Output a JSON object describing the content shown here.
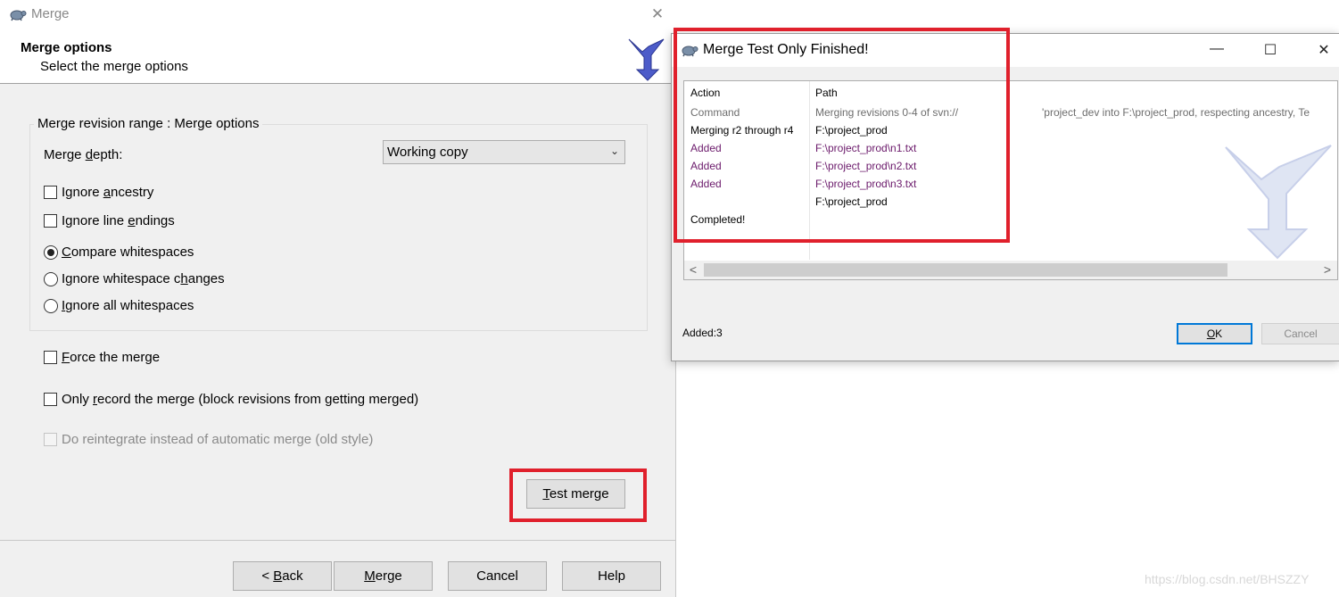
{
  "merge_window": {
    "title": "Merge",
    "close": "✕",
    "header_title": "Merge options",
    "header_subtitle": "Select the merge options",
    "group_legend": "Merge revision range : Merge options",
    "depth_label_pre": "Merge ",
    "depth_label_key": "d",
    "depth_label_post": "epth:",
    "depth_value": "Working copy",
    "ignore_ancestry": [
      "Ignore ",
      "a",
      "ncestry"
    ],
    "ignore_line_endings": [
      "Ignore line ",
      "e",
      "ndings"
    ],
    "compare_whitespaces": [
      "",
      "C",
      "ompare whitespaces"
    ],
    "ignore_ws_changes": [
      "Ignore whitespace c",
      "h",
      "anges"
    ],
    "ignore_all_ws": [
      "",
      "I",
      "gnore all whitespaces"
    ],
    "force_merge": [
      "",
      "F",
      "orce the merge"
    ],
    "only_record": [
      "Only ",
      "r",
      "ecord the merge (block revisions from getting merged)"
    ],
    "reintegrate": "Do reintegrate instead of automatic merge (old style)",
    "test_merge": [
      "",
      "T",
      "est merge"
    ],
    "back": [
      "< ",
      "B",
      "ack"
    ],
    "merge": [
      "",
      "M",
      "erge"
    ],
    "cancel": "Cancel",
    "help": "Help"
  },
  "result_window": {
    "title": "Merge Test Only Finished!",
    "minimize": "—",
    "maximize": "☐",
    "close": "✕",
    "columns": {
      "action": "Action",
      "path": "Path"
    },
    "rows": [
      {
        "action": "Command",
        "path": "Merging revisions 0-4 of svn://",
        "extra": "'project_dev into F:\\project_prod, respecting ancestry, Te",
        "kind": "cmd"
      },
      {
        "action": "Merging r2 through r4",
        "path": "F:\\project_prod",
        "extra": "",
        "kind": "normal"
      },
      {
        "action": "Added",
        "path": "F:\\project_prod\\n1.txt",
        "extra": "",
        "kind": "added"
      },
      {
        "action": "Added",
        "path": "F:\\project_prod\\n2.txt",
        "extra": "",
        "kind": "added"
      },
      {
        "action": "Added",
        "path": "F:\\project_prod\\n3.txt",
        "extra": "",
        "kind": "added"
      },
      {
        "action": "",
        "path": "F:\\project_prod",
        "extra": "",
        "kind": "normal"
      },
      {
        "action": "Completed!",
        "path": "",
        "extra": "",
        "kind": "normal"
      }
    ],
    "summary": "Added:3",
    "ok": [
      "",
      "O",
      "K"
    ],
    "cancel": "Cancel",
    "scroll_left": "<",
    "scroll_right": ">"
  },
  "watermark": "https://blog.csdn.net/BHSZZY",
  "colors": {
    "accent": "#0078d7",
    "highlight_box": "#e0202c",
    "added_text": "#6b1a6b"
  }
}
